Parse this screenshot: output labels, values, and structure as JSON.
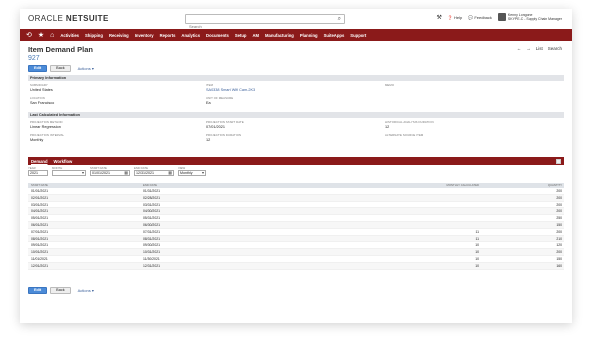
{
  "topbar": {
    "logo_a": "ORACLE ",
    "logo_b": "NETSUITE",
    "search_placeholder": "Search",
    "help": "Help",
    "feedback": "Feedback",
    "user_name": "Kenny Longone",
    "user_role": "SKYPE-C - Supply Chain Manager"
  },
  "nav": {
    "items": [
      "Activities",
      "Shipping",
      "Receiving",
      "Inventory",
      "Reports",
      "Analytics",
      "Documents",
      "Setup",
      "AM",
      "Manufacturing",
      "Planning",
      "SuiteApps",
      "Support"
    ]
  },
  "header": {
    "title": "Item Demand Plan",
    "record_number": "927",
    "edit": "Edit",
    "back": "Back",
    "actions": "Actions ▾",
    "list": "List",
    "search": "Search"
  },
  "primary": {
    "heading": "Primary Information",
    "subsidiary_label": "Subsidiary",
    "subsidiary": "United States",
    "item_label": "Item",
    "item": "SA0338 Smart Wifi Cam-2K3",
    "memo_label": "Memo",
    "location_label": "Location",
    "location": "San Francisco",
    "uom_label": "Unit of Measure",
    "uom": "Ea"
  },
  "last_calc": {
    "heading": "Last Calculated Information",
    "method_label": "Projection Method",
    "method": "Linear Regression",
    "start_label": "Projection Start Date",
    "start": "07/01/2021",
    "hist_label": "Historical Analysis Duration",
    "hist": "12",
    "interval_label": "Projection Interval",
    "interval": "Monthly",
    "duration_label": "Projection Duration",
    "duration": "12",
    "alt_label": "Alternate Source Item",
    "alt": ""
  },
  "tabs": {
    "demand": "Demand",
    "workflow": "Workflow"
  },
  "filters": {
    "year_label": "Year",
    "year": "2021",
    "month_label": "Month",
    "month": "",
    "start_label": "Start Date",
    "start": "01/01/2021",
    "end_label": "End Date",
    "end": "12/31/2021",
    "view_label": "View",
    "view": "Monthly"
  },
  "table": {
    "headers": [
      "Start Date",
      "End Date",
      "Monthly Calculated",
      "Quantity"
    ],
    "rows": [
      [
        "01/01/2021",
        "01/31/2021",
        "",
        "200"
      ],
      [
        "02/01/2021",
        "02/28/2021",
        "",
        "200"
      ],
      [
        "03/01/2021",
        "03/31/2021",
        "",
        "200"
      ],
      [
        "04/01/2021",
        "04/30/2021",
        "",
        "200"
      ],
      [
        "05/01/2021",
        "05/31/2021",
        "",
        "250"
      ],
      [
        "06/01/2021",
        "06/30/2021",
        "",
        "150"
      ],
      [
        "07/01/2021",
        "07/31/2021",
        "11",
        "200"
      ],
      [
        "08/01/2021",
        "08/31/2021",
        "11",
        "210"
      ],
      [
        "09/01/2021",
        "09/30/2021",
        "10",
        "120"
      ],
      [
        "10/01/2021",
        "10/31/2021",
        "10",
        "200"
      ],
      [
        "11/01/2021",
        "11/30/2021",
        "10",
        "150"
      ],
      [
        "12/01/2021",
        "12/31/2021",
        "10",
        "160"
      ]
    ]
  },
  "colors": {
    "nav": "#8b1a1a",
    "primary_button": "#4b8bd8",
    "section": "#e2e4e8"
  }
}
